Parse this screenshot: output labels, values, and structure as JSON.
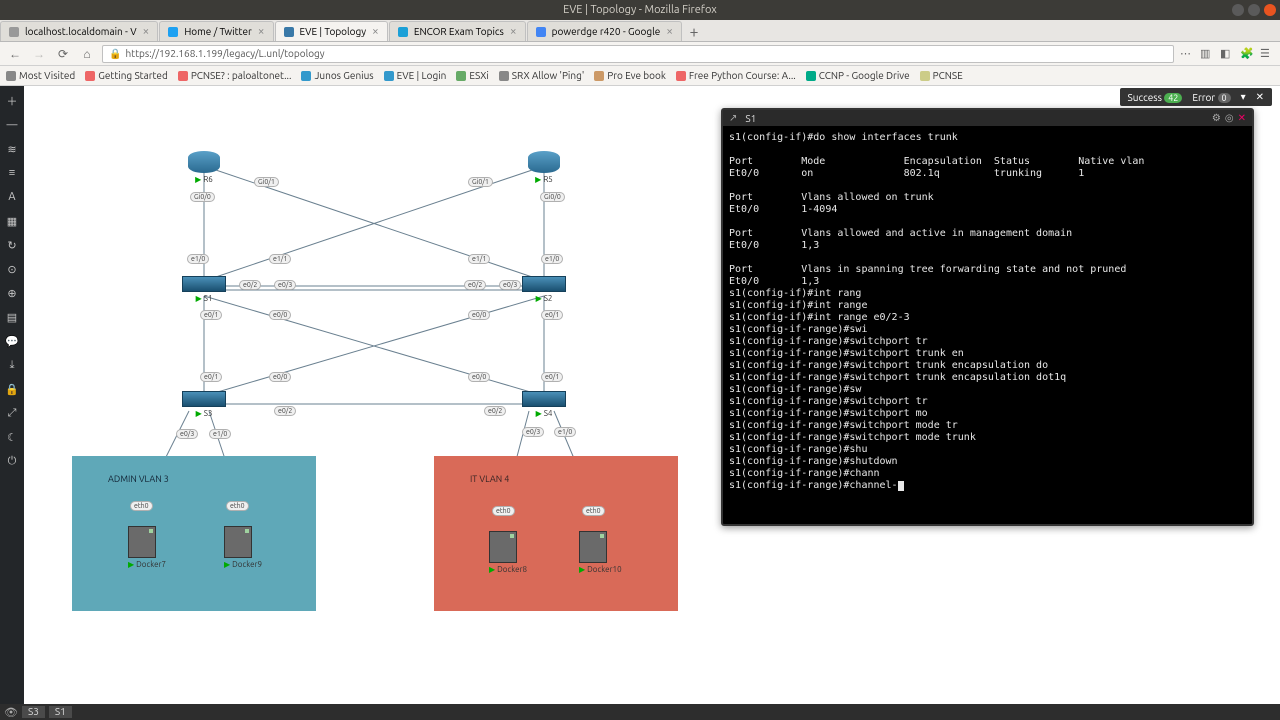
{
  "window": {
    "title": "EVE | Topology - Mozilla Firefox"
  },
  "tabs": [
    {
      "label": "localhost.localdomain - V",
      "fav": "#999"
    },
    {
      "label": "Home / Twitter",
      "fav": "#1da1f2"
    },
    {
      "label": "EVE | Topology",
      "fav": "#3a79a8",
      "active": true
    },
    {
      "label": "ENCOR Exam Topics",
      "fav": "#1ba0d7"
    },
    {
      "label": "powerdge r420 - Google",
      "fav": "#4285f4"
    }
  ],
  "url": "https://192.168.1.199/legacy/L.unl/topology",
  "bookmarks": [
    {
      "label": "Most Visited",
      "color": "#888"
    },
    {
      "label": "Getting Started",
      "color": "#e66"
    },
    {
      "label": "PCNSE? : paloaltonet...",
      "color": "#e66"
    },
    {
      "label": "Junos Genius",
      "color": "#39c"
    },
    {
      "label": "EVE | Login",
      "color": "#39c"
    },
    {
      "label": "ESXi",
      "color": "#6a6"
    },
    {
      "label": "SRX Allow 'Ping'",
      "color": "#888"
    },
    {
      "label": "Pro Eve book",
      "color": "#c96"
    },
    {
      "label": "Free Python Course: A...",
      "color": "#e66"
    },
    {
      "label": "CCNP - Google Drive",
      "color": "#0a8"
    },
    {
      "label": "PCNSE",
      "color": "#cc8"
    }
  ],
  "status": {
    "success_label": "Success",
    "success_count": "42",
    "error_label": "Error",
    "error_count": "0"
  },
  "vlan3": {
    "title": "ADMIN VLAN 3"
  },
  "vlan4": {
    "title": "IT VLAN 4"
  },
  "nodes": {
    "r6": "R6",
    "r5": "R5",
    "s1": "S1",
    "s2": "S2",
    "s3": "S3",
    "s4": "S4",
    "d7": "Docker7",
    "d9": "Docker9",
    "d8": "Docker8",
    "d10": "Docker10"
  },
  "ifaces": {
    "gi00_r6": "Gi0/0",
    "gi01_r6": "Gi0/1",
    "gi00_r5": "Gi0/0",
    "gi01_r5": "Gi0/1",
    "e10_s1": "e1/0",
    "e11_s1": "e1/1",
    "e02_s1l": "e0/2",
    "e03_s1l": "e0/3",
    "e00_s1": "e0/0",
    "e01_s1": "e0/1",
    "e10_s2": "e1/0",
    "e11_s2": "e1/1",
    "e02_s2l": "e0/2",
    "e03_s2l": "e0/3",
    "e00_s2": "e0/0",
    "e01_s2": "e0/1",
    "e00_s3t": "e0/0",
    "e01_s3t": "e0/1",
    "e00_s4t": "e0/0",
    "e01_s4t": "e0/1",
    "e02_s3": "e0/2",
    "e02_s4": "e0/2",
    "e03_s3": "e0/3",
    "e10_s3b": "e1/0",
    "e03_s4": "e0/3",
    "e10_s4b": "e1/0",
    "eth0_1": "eth0",
    "eth0_2": "eth0",
    "eth0_3": "eth0",
    "eth0_4": "eth0"
  },
  "terminal": {
    "title": "S1",
    "lines": [
      "s1(config-if)#do show interfaces trunk",
      "",
      "Port        Mode             Encapsulation  Status        Native vlan",
      "Et0/0       on               802.1q         trunking      1",
      "",
      "Port        Vlans allowed on trunk",
      "Et0/0       1-4094",
      "",
      "Port        Vlans allowed and active in management domain",
      "Et0/0       1,3",
      "",
      "Port        Vlans in spanning tree forwarding state and not pruned",
      "Et0/0       1,3",
      "s1(config-if)#int rang",
      "s1(config-if)#int range",
      "s1(config-if)#int range e0/2-3",
      "s1(config-if-range)#swi",
      "s1(config-if-range)#switchport tr",
      "s1(config-if-range)#switchport trunk en",
      "s1(config-if-range)#switchport trunk encapsulation do",
      "s1(config-if-range)#switchport trunk encapsulation dot1q",
      "s1(config-if-range)#sw",
      "s1(config-if-range)#switchport tr",
      "s1(config-if-range)#switchport mo",
      "s1(config-if-range)#switchport mode tr",
      "s1(config-if-range)#switchport mode trunk",
      "s1(config-if-range)#shu",
      "s1(config-if-range)#shutdown",
      "s1(config-if-range)#chann",
      "s1(config-if-range)#channel-"
    ]
  },
  "bottom_tabs": [
    "S3",
    "S1"
  ]
}
